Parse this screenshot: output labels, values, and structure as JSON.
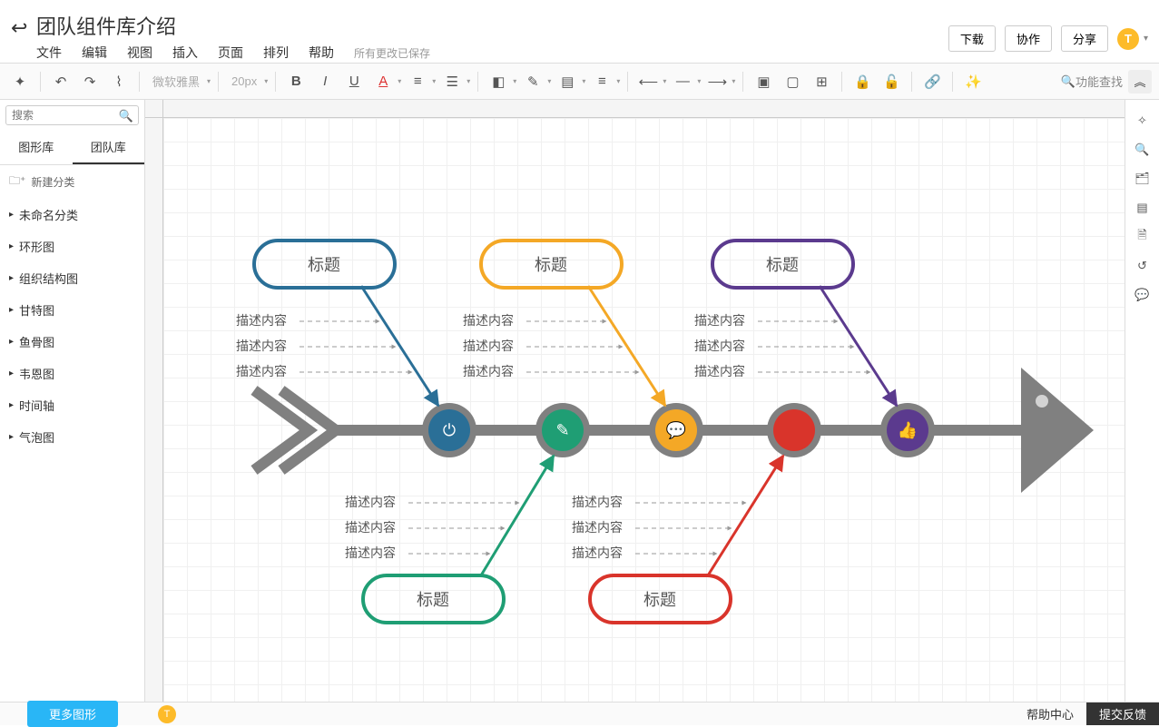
{
  "header": {
    "doc_title": "团队组件库介绍",
    "download": "下载",
    "collaborate": "协作",
    "share": "分享",
    "avatar_letter": "T"
  },
  "menu": {
    "file": "文件",
    "edit": "编辑",
    "view": "视图",
    "insert": "插入",
    "page": "页面",
    "arrange": "排列",
    "help": "帮助",
    "save_status": "所有更改已保存"
  },
  "toolbar": {
    "font_family": "微软雅黑",
    "font_size": "20px",
    "feature_search": "功能查找"
  },
  "left": {
    "search_placeholder": "搜索",
    "tab_shapes": "图形库",
    "tab_team": "团队库",
    "new_category": "新建分类",
    "more_shapes": "更多图形",
    "categories": [
      "未命名分类",
      "环形图",
      "组织结构图",
      "甘特图",
      "鱼骨图",
      "韦恩图",
      "时间轴",
      "气泡图"
    ]
  },
  "footer": {
    "help_center": "帮助中心",
    "feedback": "提交反馈",
    "avatar_letter": "T"
  },
  "diagram": {
    "titles": [
      "标题",
      "标题",
      "标题",
      "标题",
      "标题"
    ],
    "desc_label": "描述内容",
    "colors": {
      "blue": "#2a6f97",
      "orange": "#f4a826",
      "purple": "#5b3a8e",
      "green": "#1f9e74",
      "red": "#d9342b"
    }
  }
}
